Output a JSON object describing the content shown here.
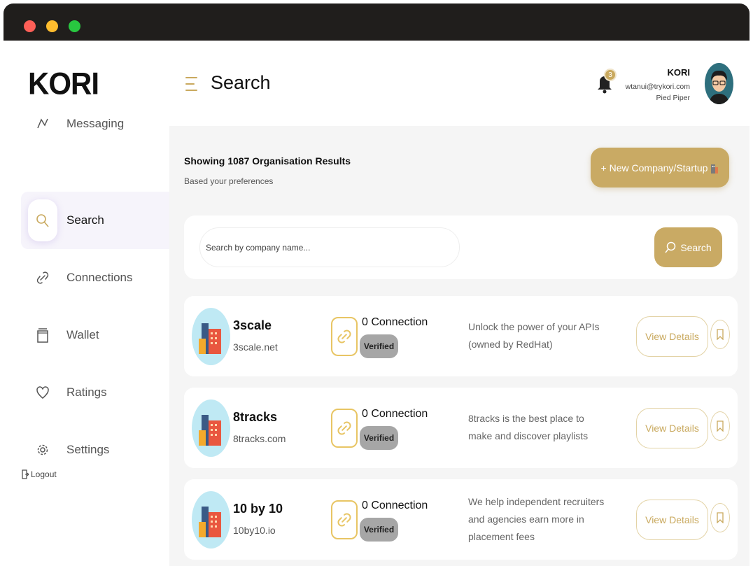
{
  "brand": {
    "name": "KORI"
  },
  "header": {
    "title": "Search",
    "notifications": {
      "count": "3"
    },
    "user": {
      "name": "KORI",
      "email": "wtanui@trykori.com",
      "company": "Pied Piper"
    }
  },
  "sidebar": {
    "items": [
      {
        "label": "Messaging",
        "icon": "message-icon"
      },
      {
        "label": "Search",
        "icon": "search-icon",
        "active": true
      },
      {
        "label": "Connections",
        "icon": "link-icon"
      },
      {
        "label": "Wallet",
        "icon": "wallet-icon"
      },
      {
        "label": "Ratings",
        "icon": "heart-icon"
      },
      {
        "label": "Settings",
        "icon": "gear-icon"
      }
    ],
    "logout_label": "Logout"
  },
  "main": {
    "results_title": "Showing 1087 Organisation Results",
    "results_subtitle": "Based your preferences",
    "new_company_label": "+ New Company/Startup",
    "search": {
      "placeholder": "Search by company name...",
      "button_label": "Search"
    }
  },
  "organisations": [
    {
      "name": "3scale",
      "domain": "3scale.net",
      "connections": "0 Connection",
      "status": "Verified",
      "description": "Unlock the power of your APIs (owned by RedHat)",
      "action_label": "View Details"
    },
    {
      "name": "8tracks",
      "domain": "8tracks.com",
      "connections": "0 Connection",
      "status": "Verified",
      "description": "8tracks is the best place to make and discover playlists",
      "action_label": "View Details"
    },
    {
      "name": "10 by 10",
      "domain": "10by10.io",
      "connections": "0 Connection",
      "status": "Verified",
      "description": "We help independent recruiters and agencies earn more in placement fees",
      "action_label": "View Details"
    }
  ],
  "colors": {
    "accent": "#c9aa64",
    "accent_border": "#e3d3a6",
    "verified_bg": "#a6a6a6",
    "background": "#f5f5f5"
  }
}
